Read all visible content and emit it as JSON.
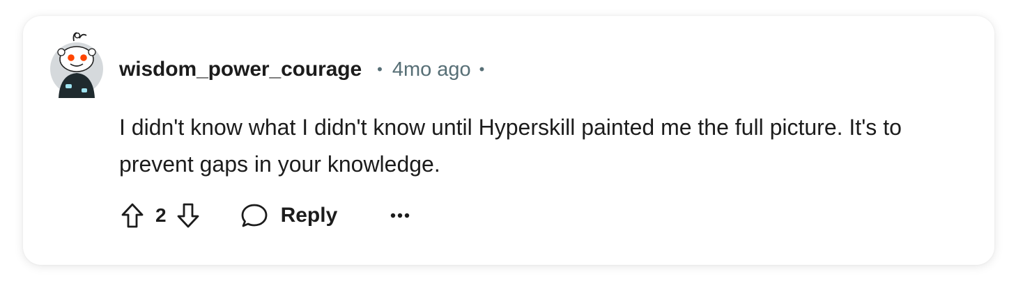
{
  "comment": {
    "author": "wisdom_power_courage",
    "separator": "•",
    "timestamp": "4mo ago",
    "trailing_separator": "•",
    "body": "I didn't know what I didn't know until Hyperskill painted me the full picture. It's to prevent gaps in your knowledge.",
    "score": "2",
    "reply_label": "Reply",
    "more_label": "···"
  },
  "icons": {
    "avatar": "reddit-snoo-avatar",
    "upvote": "arrow-up-outline-icon",
    "downvote": "arrow-down-outline-icon",
    "reply": "speech-bubble-icon",
    "more": "ellipsis-icon"
  },
  "colors": {
    "text_primary": "#1c1c1c",
    "text_secondary": "#576f76",
    "card_background": "#ffffff",
    "avatar_accent": "#ff4500"
  }
}
